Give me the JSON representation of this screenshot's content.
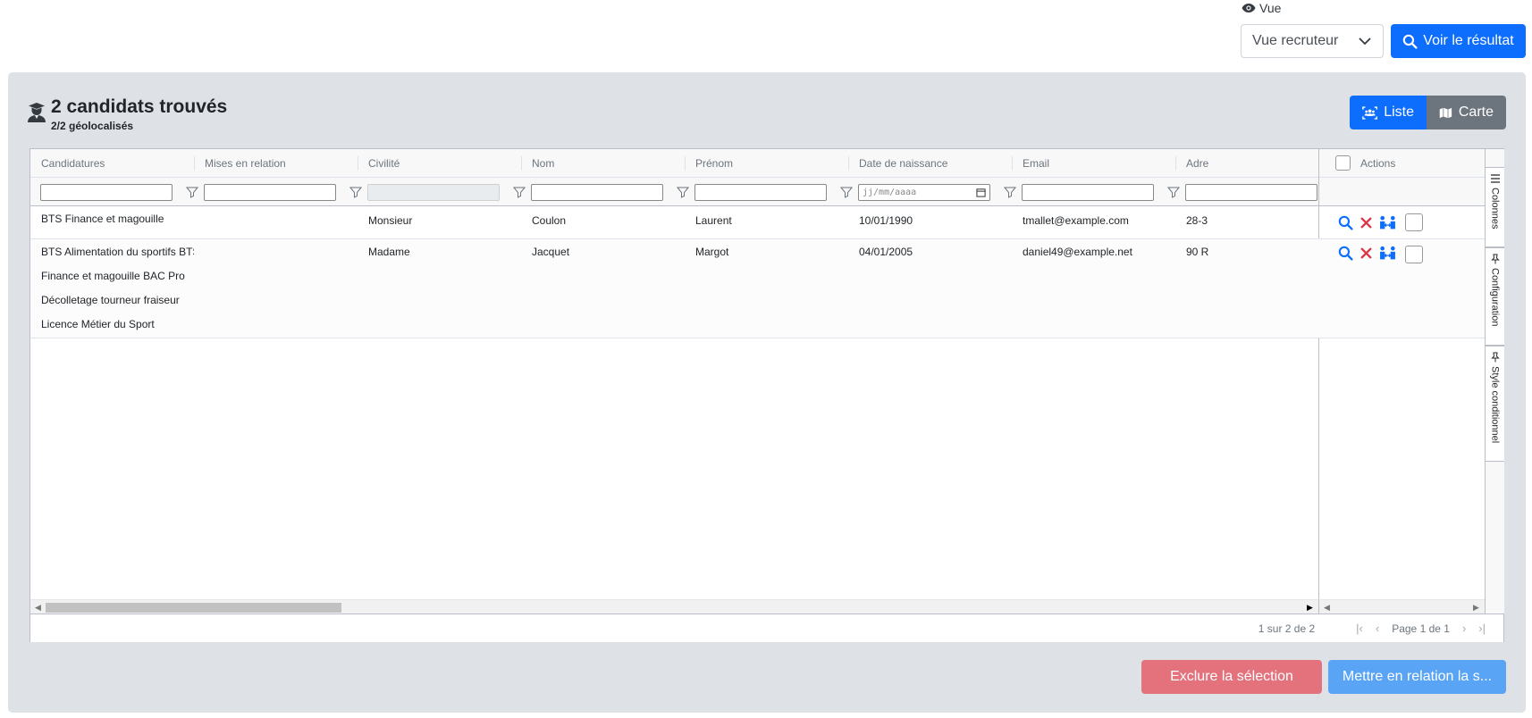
{
  "view": {
    "label": "Vue",
    "selected": "Vue recruteur",
    "submit_label": "Voir le résultat"
  },
  "results": {
    "title": "2 candidats trouvés",
    "subtitle": "2/2 géolocalisés"
  },
  "toggle": {
    "list_label": "Liste",
    "map_label": "Carte"
  },
  "grid": {
    "columns": [
      "Candidatures",
      "Mises en relation",
      "Civilité",
      "Nom",
      "Prénom",
      "Date de naissance",
      "Email",
      "Adre"
    ],
    "date_placeholder": "jj/mm/aaaa",
    "actions_header": "Actions",
    "rows": [
      {
        "candidatures": [
          "BTS Finance et magouille"
        ],
        "mises_en_relation": "",
        "civilite": "Monsieur",
        "nom": "Coulon",
        "prenom": "Laurent",
        "date_naissance": "10/01/1990",
        "email": "tmallet@example.com",
        "adresse": "28-3"
      },
      {
        "candidatures": [
          "BTS Alimentation du sportifs BTS",
          "Finance et magouille BAC Pro",
          "Décolletage tourneur fraiseur",
          "Licence Métier du Sport"
        ],
        "mises_en_relation": "",
        "civilite": "Madame",
        "nom": "Jacquet",
        "prenom": "Margot",
        "date_naissance": "04/01/2005",
        "email": "daniel49@example.net",
        "adresse": "90 R"
      }
    ],
    "side_tabs": [
      "Colonnes",
      "Configuration",
      "Style conditionnel"
    ],
    "pager": {
      "summary": "1 sur 2 de 2",
      "page": "Page 1 de 1"
    }
  },
  "footer": {
    "exclude_label": "Exclure la sélection",
    "relate_label": "Mettre en relation la s..."
  },
  "colors": {
    "primary": "#0d6efd",
    "secondary": "#6c757d",
    "danger_soft": "#e4727d",
    "primary_soft": "#5aa4f5",
    "panel_bg": "#dee1e6"
  }
}
